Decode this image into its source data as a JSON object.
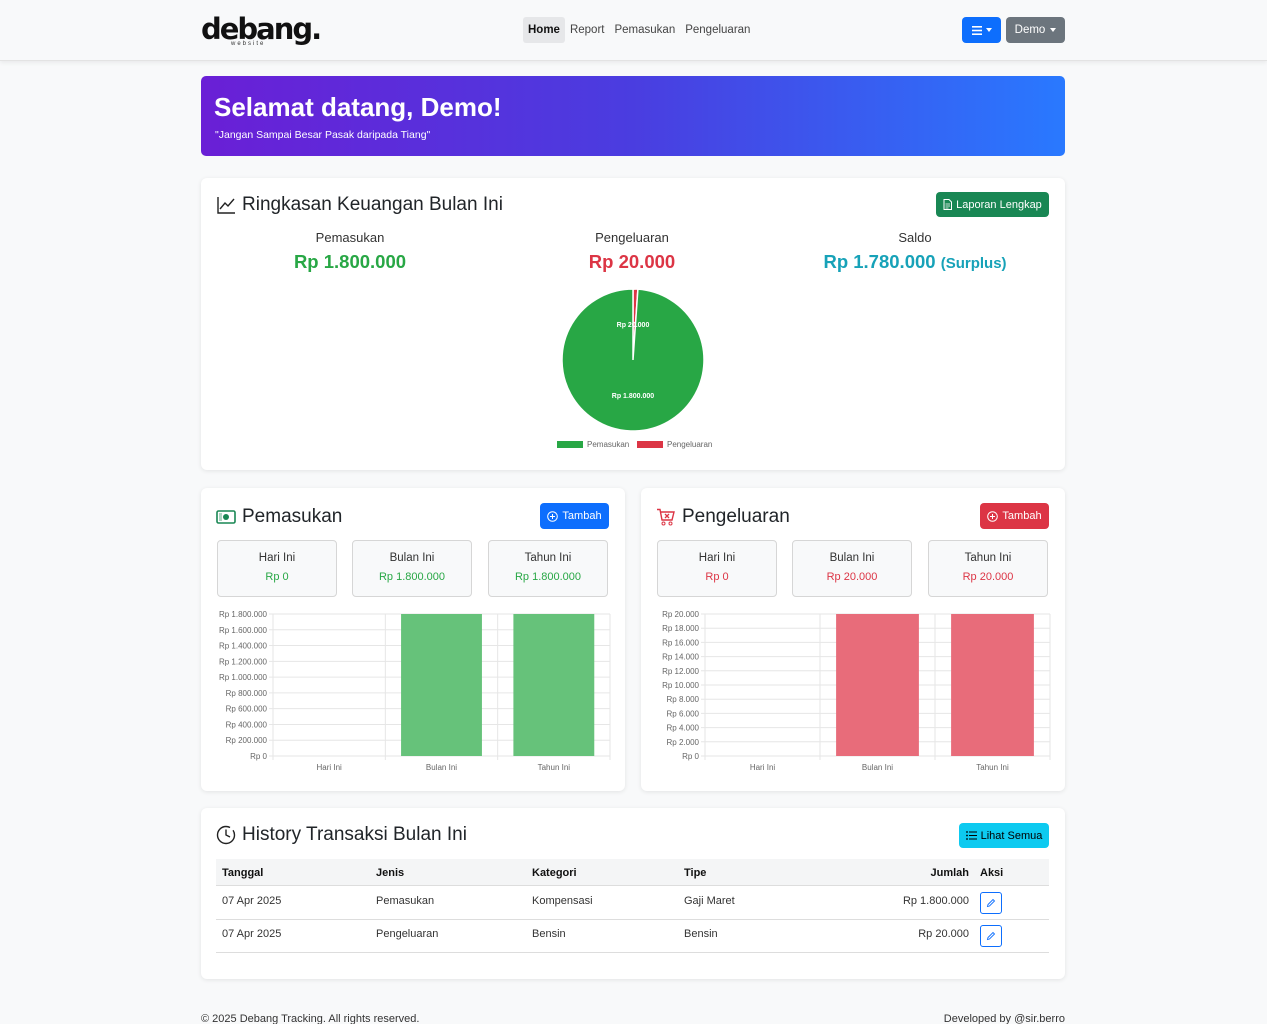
{
  "brand": {
    "name": "debang.",
    "sub": "website"
  },
  "nav": {
    "links": [
      "Home",
      "Report",
      "Pemasukan",
      "Pengeluaran"
    ],
    "user_label": "Demo"
  },
  "hero": {
    "title": "Selamat datang, Demo!",
    "subtitle": "\"Jangan Sampai Besar Pasak daripada Tiang\""
  },
  "summary": {
    "title": "Ringkasan Keuangan Bulan Ini",
    "report_button": "Laporan Lengkap",
    "income_label": "Pemasukan",
    "income_value": "Rp 1.800.000",
    "expense_label": "Pengeluaran",
    "expense_value": "Rp 20.000",
    "balance_label": "Saldo",
    "balance_value": "Rp 1.780.000",
    "balance_status": "(Surplus)"
  },
  "income_card": {
    "title": "Pemasukan",
    "add_button": "Tambah",
    "stats": [
      {
        "label": "Hari Ini",
        "value": "Rp 0"
      },
      {
        "label": "Bulan Ini",
        "value": "Rp 1.800.000"
      },
      {
        "label": "Tahun Ini",
        "value": "Rp 1.800.000"
      }
    ]
  },
  "expense_card": {
    "title": "Pengeluaran",
    "add_button": "Tambah",
    "stats": [
      {
        "label": "Hari Ini",
        "value": "Rp 0"
      },
      {
        "label": "Bulan Ini",
        "value": "Rp 20.000"
      },
      {
        "label": "Tahun Ini",
        "value": "Rp 20.000"
      }
    ]
  },
  "history": {
    "title": "History Transaksi Bulan Ini",
    "view_all_button": "Lihat Semua",
    "columns": [
      "Tanggal",
      "Jenis",
      "Kategori",
      "Tipe",
      "Jumlah",
      "Aksi"
    ],
    "rows": [
      {
        "date": "07 Apr 2025",
        "type": "Pemasukan",
        "category": "Kompensasi",
        "subtype": "Gaji Maret",
        "amount": "Rp 1.800.000",
        "color": "#28a745"
      },
      {
        "date": "07 Apr 2025",
        "type": "Pengeluaran",
        "category": "Bensin",
        "subtype": "Bensin",
        "amount": "Rp 20.000",
        "color": "#dc3545"
      }
    ]
  },
  "footer": {
    "left": "© 2025 Debang Tracking. All rights reserved.",
    "right": "Developed by @sir.berro"
  },
  "colors": {
    "income": "#28a745",
    "expense": "#dc3545",
    "balance": "#17a2b8",
    "primary": "#0d6efd"
  },
  "chart_data": [
    {
      "type": "pie",
      "labels": [
        "Pemasukan",
        "Pengeluaran"
      ],
      "values": [
        1800000,
        20000
      ],
      "data_labels": [
        "Rp 1.800.000",
        "Rp 20.000"
      ],
      "colors": [
        "#28a745",
        "#dc3545"
      ],
      "legend": "bottom"
    },
    {
      "type": "bar",
      "categories": [
        "Hari Ini",
        "Bulan Ini",
        "Tahun Ini"
      ],
      "values": [
        0,
        1800000,
        1800000
      ],
      "ylim": [
        0,
        1800000
      ],
      "yticks": [
        "Rp 0",
        "Rp 200.000",
        "Rp 400.000",
        "Rp 600.000",
        "Rp 800.000",
        "Rp 1.000.000",
        "Rp 1.200.000",
        "Rp 1.400.000",
        "Rp 1.600.000",
        "Rp 1.800.000"
      ],
      "color": "#66c27a",
      "grid": true
    },
    {
      "type": "bar",
      "categories": [
        "Hari Ini",
        "Bulan Ini",
        "Tahun Ini"
      ],
      "values": [
        0,
        20000,
        20000
      ],
      "ylim": [
        0,
        20000
      ],
      "yticks": [
        "Rp 0",
        "Rp 2.000",
        "Rp 4.000",
        "Rp 6.000",
        "Rp 8.000",
        "Rp 10.000",
        "Rp 12.000",
        "Rp 14.000",
        "Rp 16.000",
        "Rp 18.000",
        "Rp 20.000"
      ],
      "color": "#e86c7a",
      "grid": true
    }
  ]
}
